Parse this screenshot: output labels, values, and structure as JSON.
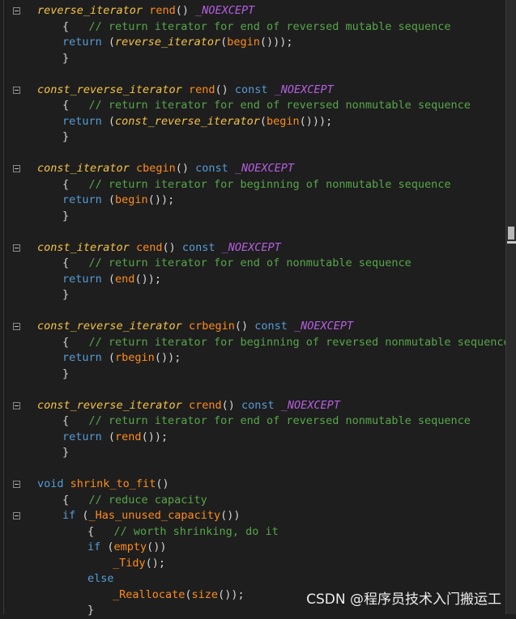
{
  "editor": {
    "lines": [
      {
        "fold": true,
        "indent": 0,
        "tokens": [
          [
            "type",
            "reverse_iterator"
          ],
          [
            "plain",
            " "
          ],
          [
            "fn",
            "rend"
          ],
          [
            "punc",
            "() "
          ],
          [
            "macro",
            "_NOEXCEPT"
          ]
        ]
      },
      {
        "fold": false,
        "indent": 1,
        "tokens": [
          [
            "punc",
            "{   "
          ],
          [
            "cm",
            "// return iterator for end of reversed mutable sequence"
          ]
        ]
      },
      {
        "fold": false,
        "indent": 1,
        "tokens": [
          [
            "kw",
            "return"
          ],
          [
            "punc",
            " ("
          ],
          [
            "type",
            "reverse_iterator"
          ],
          [
            "punc",
            "("
          ],
          [
            "fn",
            "begin"
          ],
          [
            "punc",
            "()));"
          ]
        ]
      },
      {
        "fold": false,
        "indent": 1,
        "tokens": [
          [
            "punc",
            "}"
          ]
        ]
      },
      {
        "fold": false,
        "indent": 0,
        "tokens": []
      },
      {
        "fold": true,
        "indent": 0,
        "tokens": [
          [
            "type",
            "const_reverse_iterator"
          ],
          [
            "plain",
            " "
          ],
          [
            "fn",
            "rend"
          ],
          [
            "punc",
            "() "
          ],
          [
            "kw",
            "const"
          ],
          [
            "plain",
            " "
          ],
          [
            "macro",
            "_NOEXCEPT"
          ]
        ]
      },
      {
        "fold": false,
        "indent": 1,
        "tokens": [
          [
            "punc",
            "{   "
          ],
          [
            "cm",
            "// return iterator for end of reversed nonmutable sequence"
          ]
        ]
      },
      {
        "fold": false,
        "indent": 1,
        "tokens": [
          [
            "kw",
            "return"
          ],
          [
            "punc",
            " ("
          ],
          [
            "type",
            "const_reverse_iterator"
          ],
          [
            "punc",
            "("
          ],
          [
            "fn",
            "begin"
          ],
          [
            "punc",
            "()));"
          ]
        ]
      },
      {
        "fold": false,
        "indent": 1,
        "tokens": [
          [
            "punc",
            "}"
          ]
        ]
      },
      {
        "fold": false,
        "indent": 0,
        "tokens": []
      },
      {
        "fold": true,
        "indent": 0,
        "tokens": [
          [
            "type",
            "const_iterator"
          ],
          [
            "plain",
            " "
          ],
          [
            "fn",
            "cbegin"
          ],
          [
            "punc",
            "() "
          ],
          [
            "kw",
            "const"
          ],
          [
            "plain",
            " "
          ],
          [
            "macro",
            "_NOEXCEPT"
          ]
        ]
      },
      {
        "fold": false,
        "indent": 1,
        "tokens": [
          [
            "punc",
            "{   "
          ],
          [
            "cm",
            "// return iterator for beginning of nonmutable sequence"
          ]
        ]
      },
      {
        "fold": false,
        "indent": 1,
        "tokens": [
          [
            "kw",
            "return"
          ],
          [
            "punc",
            " ("
          ],
          [
            "fn",
            "begin"
          ],
          [
            "punc",
            "());"
          ]
        ]
      },
      {
        "fold": false,
        "indent": 1,
        "tokens": [
          [
            "punc",
            "}"
          ]
        ]
      },
      {
        "fold": false,
        "indent": 0,
        "tokens": []
      },
      {
        "fold": true,
        "indent": 0,
        "tokens": [
          [
            "type",
            "const_iterator"
          ],
          [
            "plain",
            " "
          ],
          [
            "fn",
            "cend"
          ],
          [
            "punc",
            "() "
          ],
          [
            "kw",
            "const"
          ],
          [
            "plain",
            " "
          ],
          [
            "macro",
            "_NOEXCEPT"
          ]
        ]
      },
      {
        "fold": false,
        "indent": 1,
        "tokens": [
          [
            "punc",
            "{   "
          ],
          [
            "cm",
            "// return iterator for end of nonmutable sequence"
          ]
        ]
      },
      {
        "fold": false,
        "indent": 1,
        "tokens": [
          [
            "kw",
            "return"
          ],
          [
            "punc",
            " ("
          ],
          [
            "fn",
            "end"
          ],
          [
            "punc",
            "());"
          ]
        ]
      },
      {
        "fold": false,
        "indent": 1,
        "tokens": [
          [
            "punc",
            "}"
          ]
        ]
      },
      {
        "fold": false,
        "indent": 0,
        "tokens": []
      },
      {
        "fold": true,
        "indent": 0,
        "tokens": [
          [
            "type",
            "const_reverse_iterator"
          ],
          [
            "plain",
            " "
          ],
          [
            "fn",
            "crbegin"
          ],
          [
            "punc",
            "() "
          ],
          [
            "kw",
            "const"
          ],
          [
            "plain",
            " "
          ],
          [
            "macro",
            "_NOEXCEPT"
          ]
        ]
      },
      {
        "fold": false,
        "indent": 1,
        "tokens": [
          [
            "punc",
            "{   "
          ],
          [
            "cm",
            "// return iterator for beginning of reversed nonmutable sequence"
          ]
        ]
      },
      {
        "fold": false,
        "indent": 1,
        "tokens": [
          [
            "kw",
            "return"
          ],
          [
            "punc",
            " ("
          ],
          [
            "fn",
            "rbegin"
          ],
          [
            "punc",
            "());"
          ]
        ]
      },
      {
        "fold": false,
        "indent": 1,
        "tokens": [
          [
            "punc",
            "}"
          ]
        ]
      },
      {
        "fold": false,
        "indent": 0,
        "tokens": []
      },
      {
        "fold": true,
        "indent": 0,
        "tokens": [
          [
            "type",
            "const_reverse_iterator"
          ],
          [
            "plain",
            " "
          ],
          [
            "fn",
            "crend"
          ],
          [
            "punc",
            "() "
          ],
          [
            "kw",
            "const"
          ],
          [
            "plain",
            " "
          ],
          [
            "macro",
            "_NOEXCEPT"
          ]
        ]
      },
      {
        "fold": false,
        "indent": 1,
        "tokens": [
          [
            "punc",
            "{   "
          ],
          [
            "cm",
            "// return iterator for end of reversed nonmutable sequence"
          ]
        ]
      },
      {
        "fold": false,
        "indent": 1,
        "tokens": [
          [
            "kw",
            "return"
          ],
          [
            "punc",
            " ("
          ],
          [
            "fn",
            "rend"
          ],
          [
            "punc",
            "());"
          ]
        ]
      },
      {
        "fold": false,
        "indent": 1,
        "tokens": [
          [
            "punc",
            "}"
          ]
        ]
      },
      {
        "fold": false,
        "indent": 0,
        "tokens": []
      },
      {
        "fold": true,
        "indent": 0,
        "tokens": [
          [
            "kw",
            "void"
          ],
          [
            "plain",
            " "
          ],
          [
            "fn",
            "shrink_to_fit"
          ],
          [
            "punc",
            "()"
          ]
        ]
      },
      {
        "fold": false,
        "indent": 1,
        "tokens": [
          [
            "punc",
            "{   "
          ],
          [
            "cm",
            "// reduce capacity"
          ]
        ]
      },
      {
        "fold": true,
        "indent": 1,
        "tokens": [
          [
            "kw",
            "if"
          ],
          [
            "punc",
            " ("
          ],
          [
            "fn",
            "_Has_unused_capacity"
          ],
          [
            "punc",
            "())"
          ]
        ]
      },
      {
        "fold": false,
        "indent": 2,
        "tokens": [
          [
            "punc",
            "{   "
          ],
          [
            "cm",
            "// worth shrinking, do it"
          ]
        ]
      },
      {
        "fold": false,
        "indent": 2,
        "tokens": [
          [
            "kw",
            "if"
          ],
          [
            "punc",
            " ("
          ],
          [
            "fn",
            "empty"
          ],
          [
            "punc",
            "())"
          ]
        ]
      },
      {
        "fold": false,
        "indent": 3,
        "tokens": [
          [
            "fn",
            "_Tidy"
          ],
          [
            "punc",
            "();"
          ]
        ]
      },
      {
        "fold": false,
        "indent": 2,
        "tokens": [
          [
            "kw",
            "else"
          ]
        ]
      },
      {
        "fold": false,
        "indent": 3,
        "tokens": [
          [
            "fn",
            "_Reallocate"
          ],
          [
            "punc",
            "("
          ],
          [
            "fn",
            "size"
          ],
          [
            "punc",
            "());"
          ]
        ]
      },
      {
        "fold": false,
        "indent": 2,
        "tokens": [
          [
            "punc",
            "}"
          ]
        ]
      }
    ]
  },
  "watermark": {
    "text": "CSDN @程序员技术入门搬运工"
  }
}
